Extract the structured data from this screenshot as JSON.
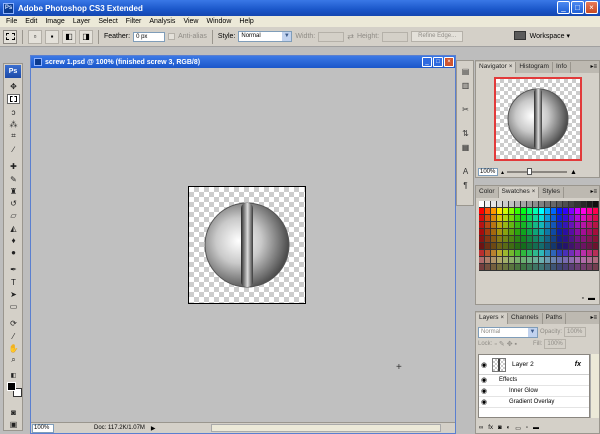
{
  "app": {
    "title": "Adobe Photoshop CS3 Extended",
    "logo": "Ps",
    "window_buttons": [
      "_",
      "□",
      "×"
    ]
  },
  "menu": [
    "File",
    "Edit",
    "Image",
    "Layer",
    "Select",
    "Filter",
    "Analysis",
    "View",
    "Window",
    "Help"
  ],
  "options": {
    "feather_label": "Feather:",
    "feather_value": "0 px",
    "antialias_label": "Anti-alias",
    "style_label": "Style:",
    "style_value": "Normal",
    "width_label": "Width:",
    "height_label": "Height:",
    "refine_label": "Refine Edge...",
    "workspace_label": "Workspace ▾"
  },
  "document": {
    "title": "screw 1.psd @ 100% (finished screw 3, RGB/8)",
    "zoom": "100%",
    "doc_info": "Doc: 117.2K/1.07M"
  },
  "navigator": {
    "tabs": [
      {
        "label": "Navigator",
        "close": "×",
        "active": true
      },
      {
        "label": "Histogram",
        "close": "",
        "active": false
      },
      {
        "label": "Info",
        "close": "",
        "active": false
      }
    ],
    "zoom": "100%"
  },
  "swatches_panel": {
    "tabs": [
      {
        "label": "Color",
        "close": "",
        "active": false
      },
      {
        "label": "Swatches",
        "close": "×",
        "active": true
      },
      {
        "label": "Styles",
        "close": "",
        "active": false
      }
    ]
  },
  "layers_panel": {
    "tabs": [
      {
        "label": "Layers",
        "close": "×",
        "active": true
      },
      {
        "label": "Channels",
        "close": "",
        "active": false
      },
      {
        "label": "Paths",
        "close": "",
        "active": false
      }
    ],
    "blend_mode": "Normal",
    "opacity_label": "Opacity:",
    "opacity_value": "100%",
    "lock_label": "Lock:",
    "fill_label": "Fill:",
    "fill_value": "100%",
    "layer_name": "Layer 2",
    "fx_label": "fx",
    "effects_label": "Effects",
    "effects": [
      "Inner Glow",
      "Gradient Overlay"
    ]
  },
  "colors": {
    "title_blue": "#1a56c9",
    "nav_frame": "#e23a3a",
    "ui_gray": "#d4d0c8"
  }
}
